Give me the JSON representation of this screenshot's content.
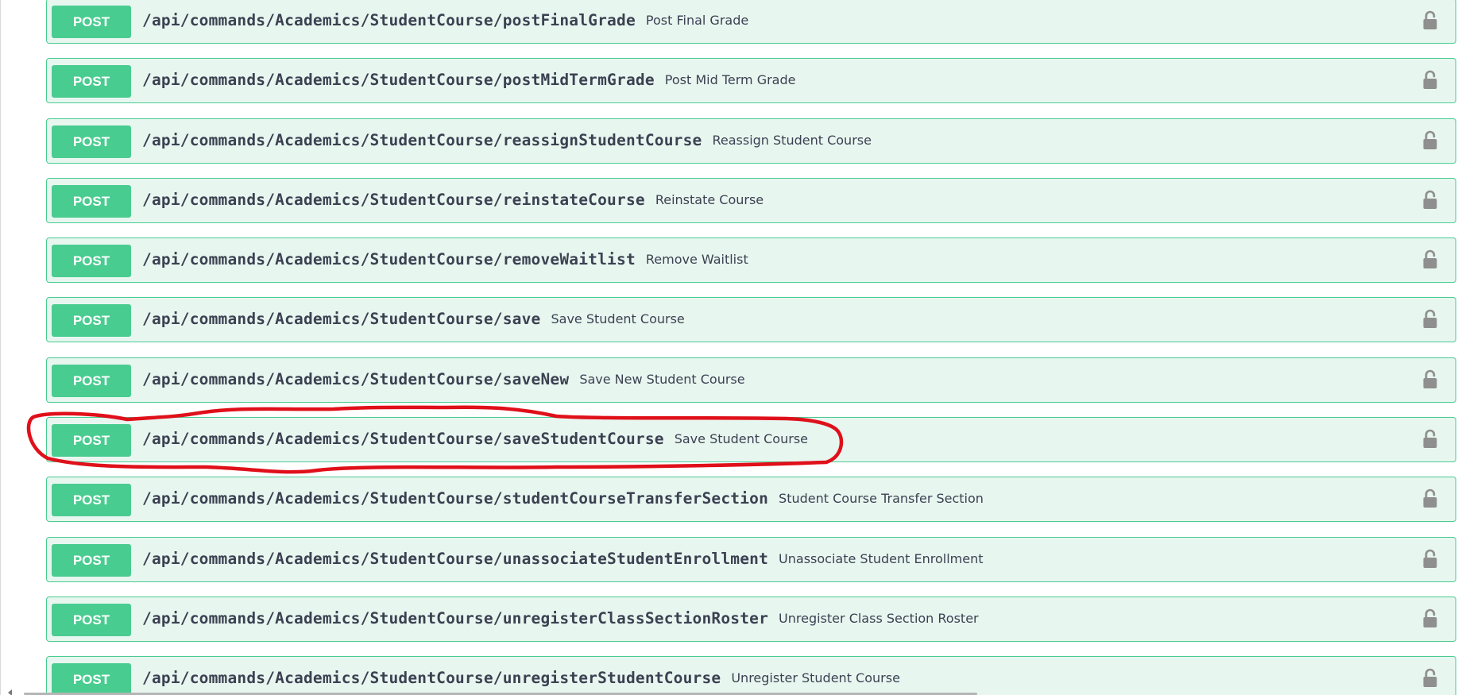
{
  "colors": {
    "post_method": "#49cc90",
    "post_background": "#e8f6f0",
    "annotation_stroke": "#e0101a",
    "lock_icon": "#8f8f8f"
  },
  "operations": [
    {
      "method": "POST",
      "path": "/api/commands/Academics/StudentCourse/postFinalGrade",
      "summary": "Post Final Grade"
    },
    {
      "method": "POST",
      "path": "/api/commands/Academics/StudentCourse/postMidTermGrade",
      "summary": "Post Mid Term Grade"
    },
    {
      "method": "POST",
      "path": "/api/commands/Academics/StudentCourse/reassignStudentCourse",
      "summary": "Reassign Student Course"
    },
    {
      "method": "POST",
      "path": "/api/commands/Academics/StudentCourse/reinstateCourse",
      "summary": "Reinstate Course"
    },
    {
      "method": "POST",
      "path": "/api/commands/Academics/StudentCourse/removeWaitlist",
      "summary": "Remove Waitlist"
    },
    {
      "method": "POST",
      "path": "/api/commands/Academics/StudentCourse/save",
      "summary": "Save Student Course"
    },
    {
      "method": "POST",
      "path": "/api/commands/Academics/StudentCourse/saveNew",
      "summary": "Save New Student Course"
    },
    {
      "method": "POST",
      "path": "/api/commands/Academics/StudentCourse/saveStudentCourse",
      "summary": "Save Student Course"
    },
    {
      "method": "POST",
      "path": "/api/commands/Academics/StudentCourse/studentCourseTransferSection",
      "summary": "Student Course Transfer Section"
    },
    {
      "method": "POST",
      "path": "/api/commands/Academics/StudentCourse/unassociateStudentEnrollment",
      "summary": "Unassociate Student Enrollment"
    },
    {
      "method": "POST",
      "path": "/api/commands/Academics/StudentCourse/unregisterClassSectionRoster",
      "summary": "Unregister Class Section Roster"
    },
    {
      "method": "POST",
      "path": "/api/commands/Academics/StudentCourse/unregisterStudentCourse",
      "summary": "Unregister Student Course"
    }
  ],
  "icons": {
    "lock": "lock-icon"
  },
  "annotation": {
    "highlighted_operation": "/api/commands/Academics/StudentCourse/saveStudentCourse"
  }
}
